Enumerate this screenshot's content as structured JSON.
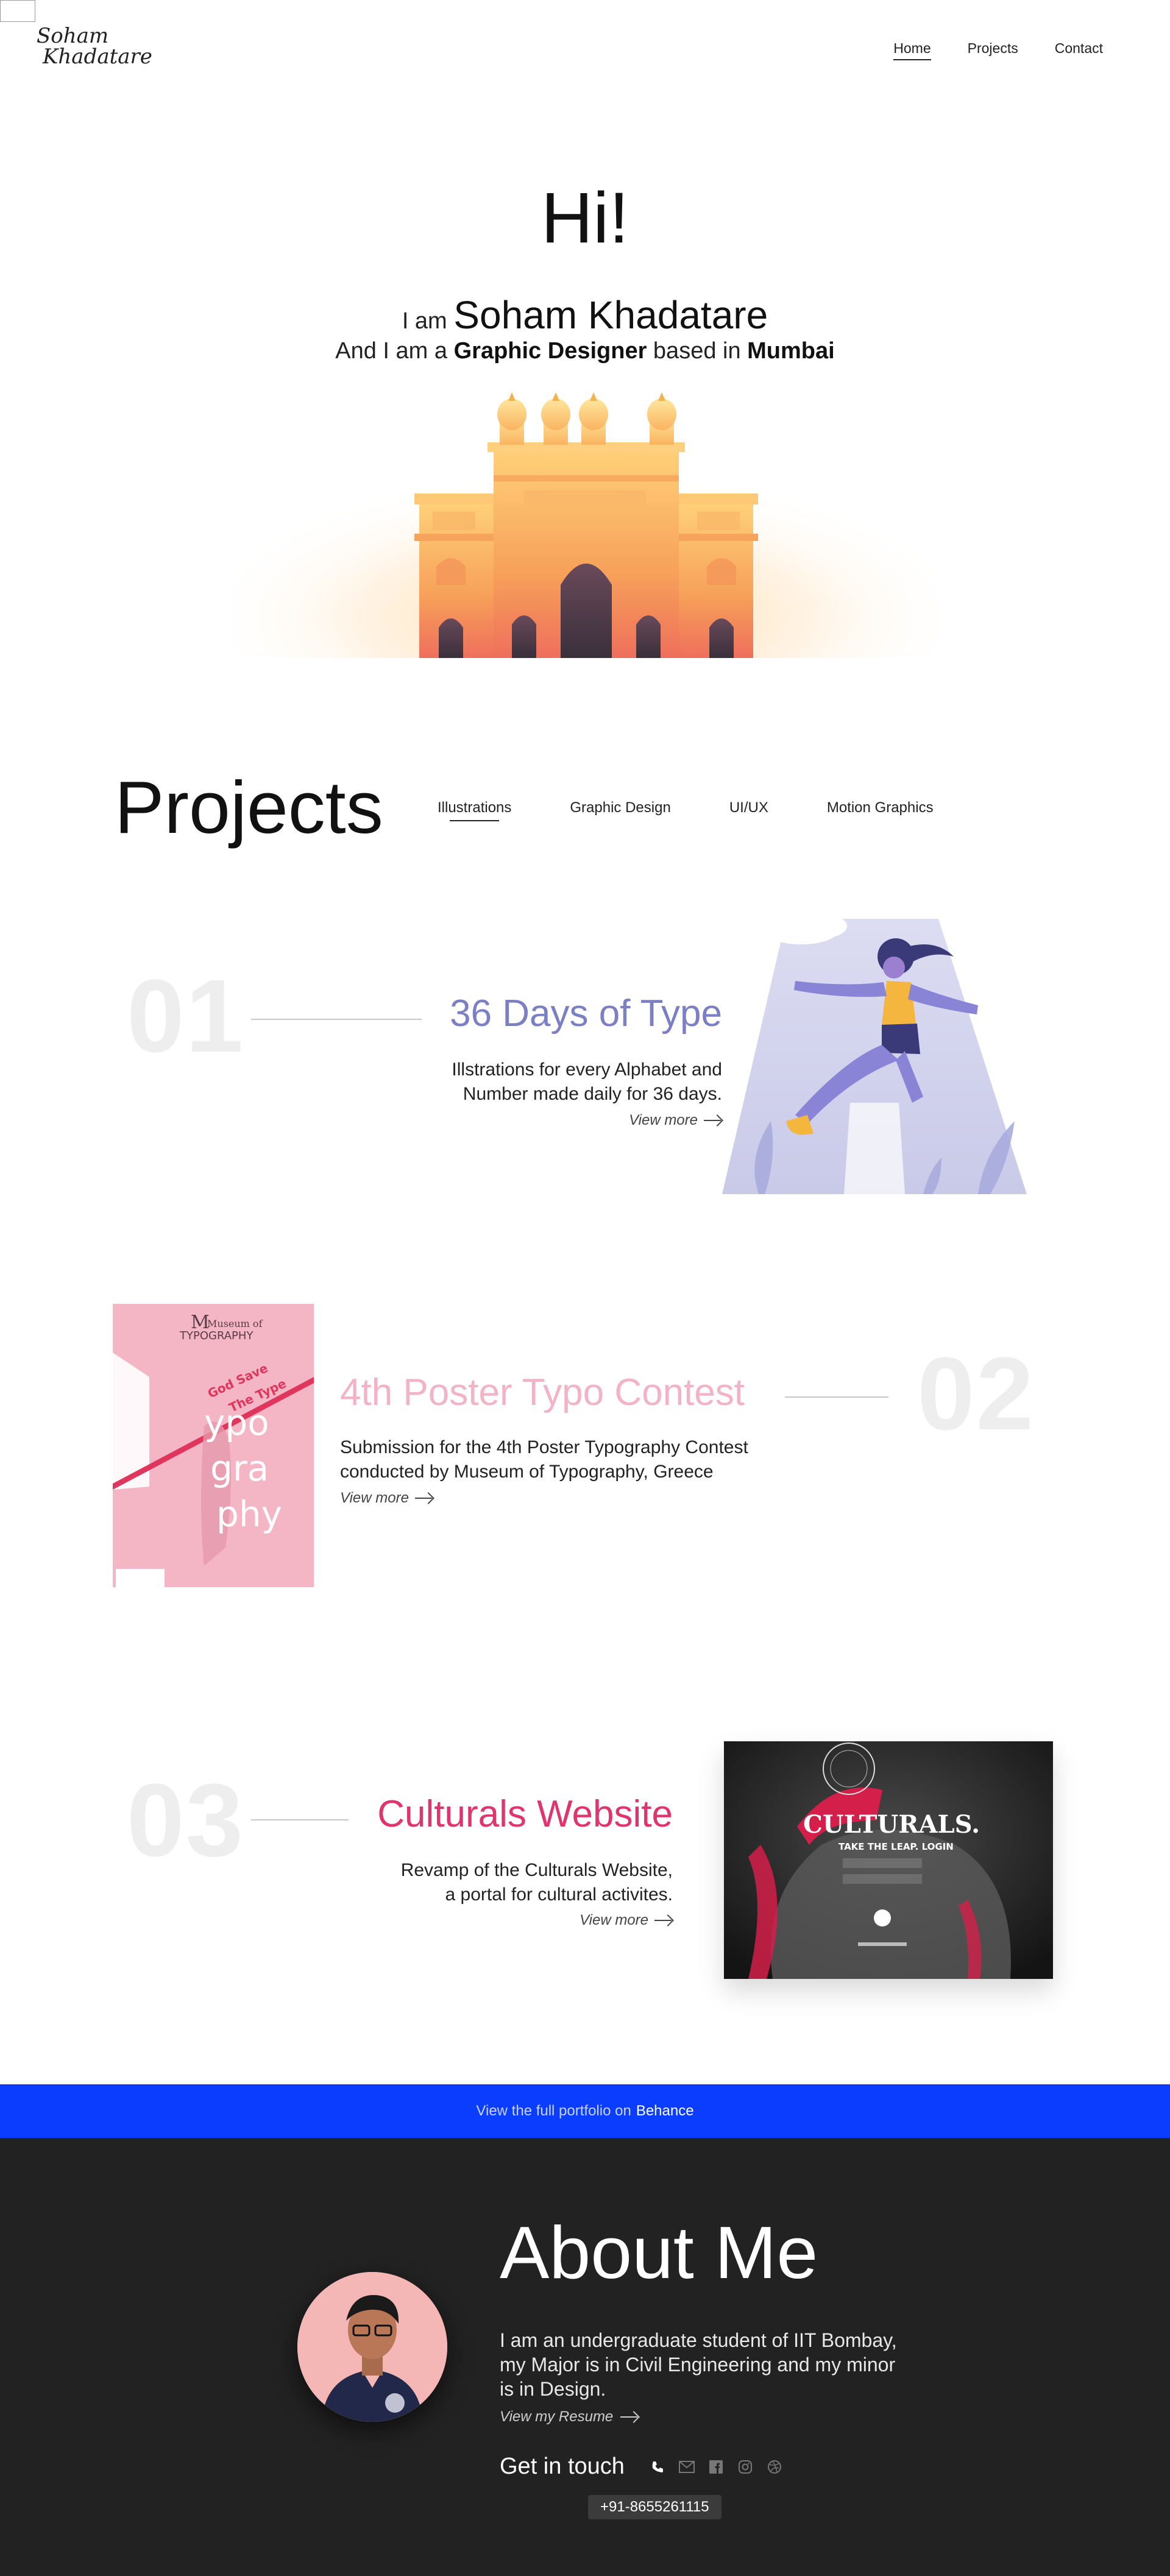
{
  "nav": {
    "logo_line1": "Soham",
    "logo_line2": "Khadatare",
    "links": [
      "Home",
      "Projects",
      "Contact"
    ]
  },
  "hero": {
    "greeting": "Hi!",
    "i_am": "I am",
    "name": "Soham Khadatare",
    "and_i_am": "And I am a",
    "role": "Graphic Designer",
    "based_in": "based in",
    "city": "Mumbai"
  },
  "projects": {
    "title": "Projects",
    "filters": [
      "Illustrations",
      "Graphic Design",
      "UI/UX",
      "Motion Graphics"
    ],
    "items": [
      {
        "number": "01",
        "title": "36 Days of Type",
        "title_color": "#7b7fc4",
        "desc_line1": "Illstrations for every Alphabet and",
        "desc_line2": "Number made daily for 36 days.",
        "view_more": "View more"
      },
      {
        "number": "02",
        "title": "4th Poster Typo Contest",
        "title_color": "#f2b3c6",
        "desc_line1": "Submission for the 4th Poster Typography Contest",
        "desc_line2": "conducted by Museum of Typography, Greece",
        "view_more": "View more",
        "poster_museum": "Museum of",
        "poster_typography": "TYPOGRAPHY",
        "poster_slogan1": "God Save",
        "poster_slogan2": "The Type",
        "poster_big1": "ypo",
        "poster_big2": "gra",
        "poster_big3": "phy"
      },
      {
        "number": "03",
        "title": "Culturals Website",
        "title_color": "#e0356c",
        "desc_line1": "Revamp of the Culturals Website,",
        "desc_line2": "a portal for cultural activites.",
        "view_more": "View more",
        "card_title": "CULTURALS.",
        "card_sub": "TAKE THE LEAP. LOGIN"
      }
    ]
  },
  "behance": {
    "prefix": "View the full portfolio on",
    "link": "Behance"
  },
  "about": {
    "title": "About Me",
    "text": "I am  an undergraduate student of IIT Bombay, my Major is in Civil Engineering and my minor is in Design.",
    "resume": "View my Resume",
    "get_in_touch": "Get in touch",
    "phone": "+91-8655261115",
    "icons": [
      "phone-icon",
      "mail-icon",
      "facebook-icon",
      "instagram-icon",
      "dribbble-icon"
    ]
  }
}
